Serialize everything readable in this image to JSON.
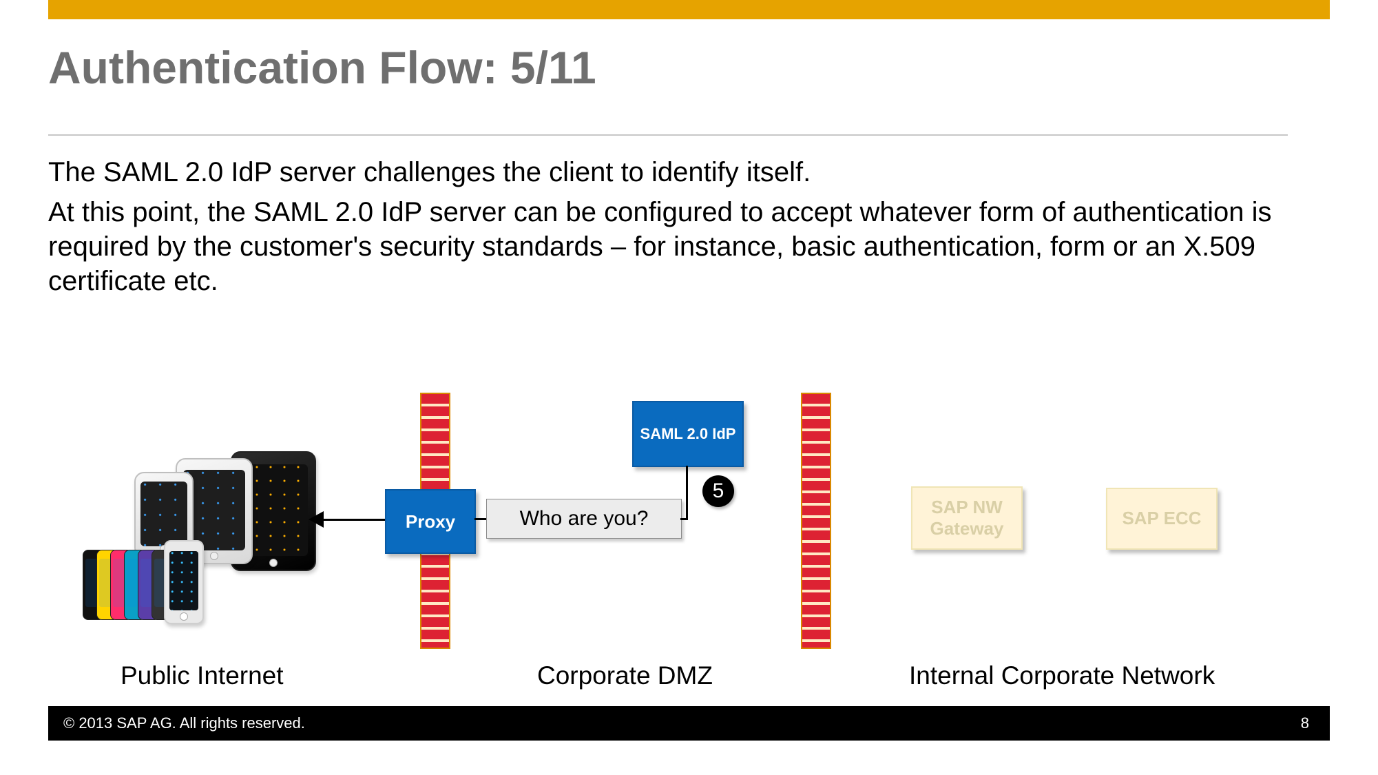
{
  "title": "Authentication Flow: 5/11",
  "body": {
    "p1": "The SAML 2.0 IdP server challenges the client to identify itself.",
    "p2": "At this point, the SAML 2.0 IdP server can be configured to accept whatever form of authentication is required by the customer's security standards – for instance, basic authentication, form or an X.509 certificate etc."
  },
  "diagram": {
    "zones": {
      "internet": "Public Internet",
      "dmz": "Corporate DMZ",
      "internal": "Internal Corporate Network"
    },
    "nodes": {
      "proxy": "Proxy",
      "saml_idp": "SAML 2.0 IdP",
      "nw_gateway": "SAP NW Gateway",
      "ecc": "SAP ECC"
    },
    "message": "Who are you?",
    "step": "5"
  },
  "footer": {
    "copyright": "©  2013 SAP AG. All rights reserved.",
    "page": "8"
  },
  "colors": {
    "accent_bar": "#e6a300",
    "box_blue": "#0a6bbf",
    "faded_box": "#fff3d7"
  }
}
